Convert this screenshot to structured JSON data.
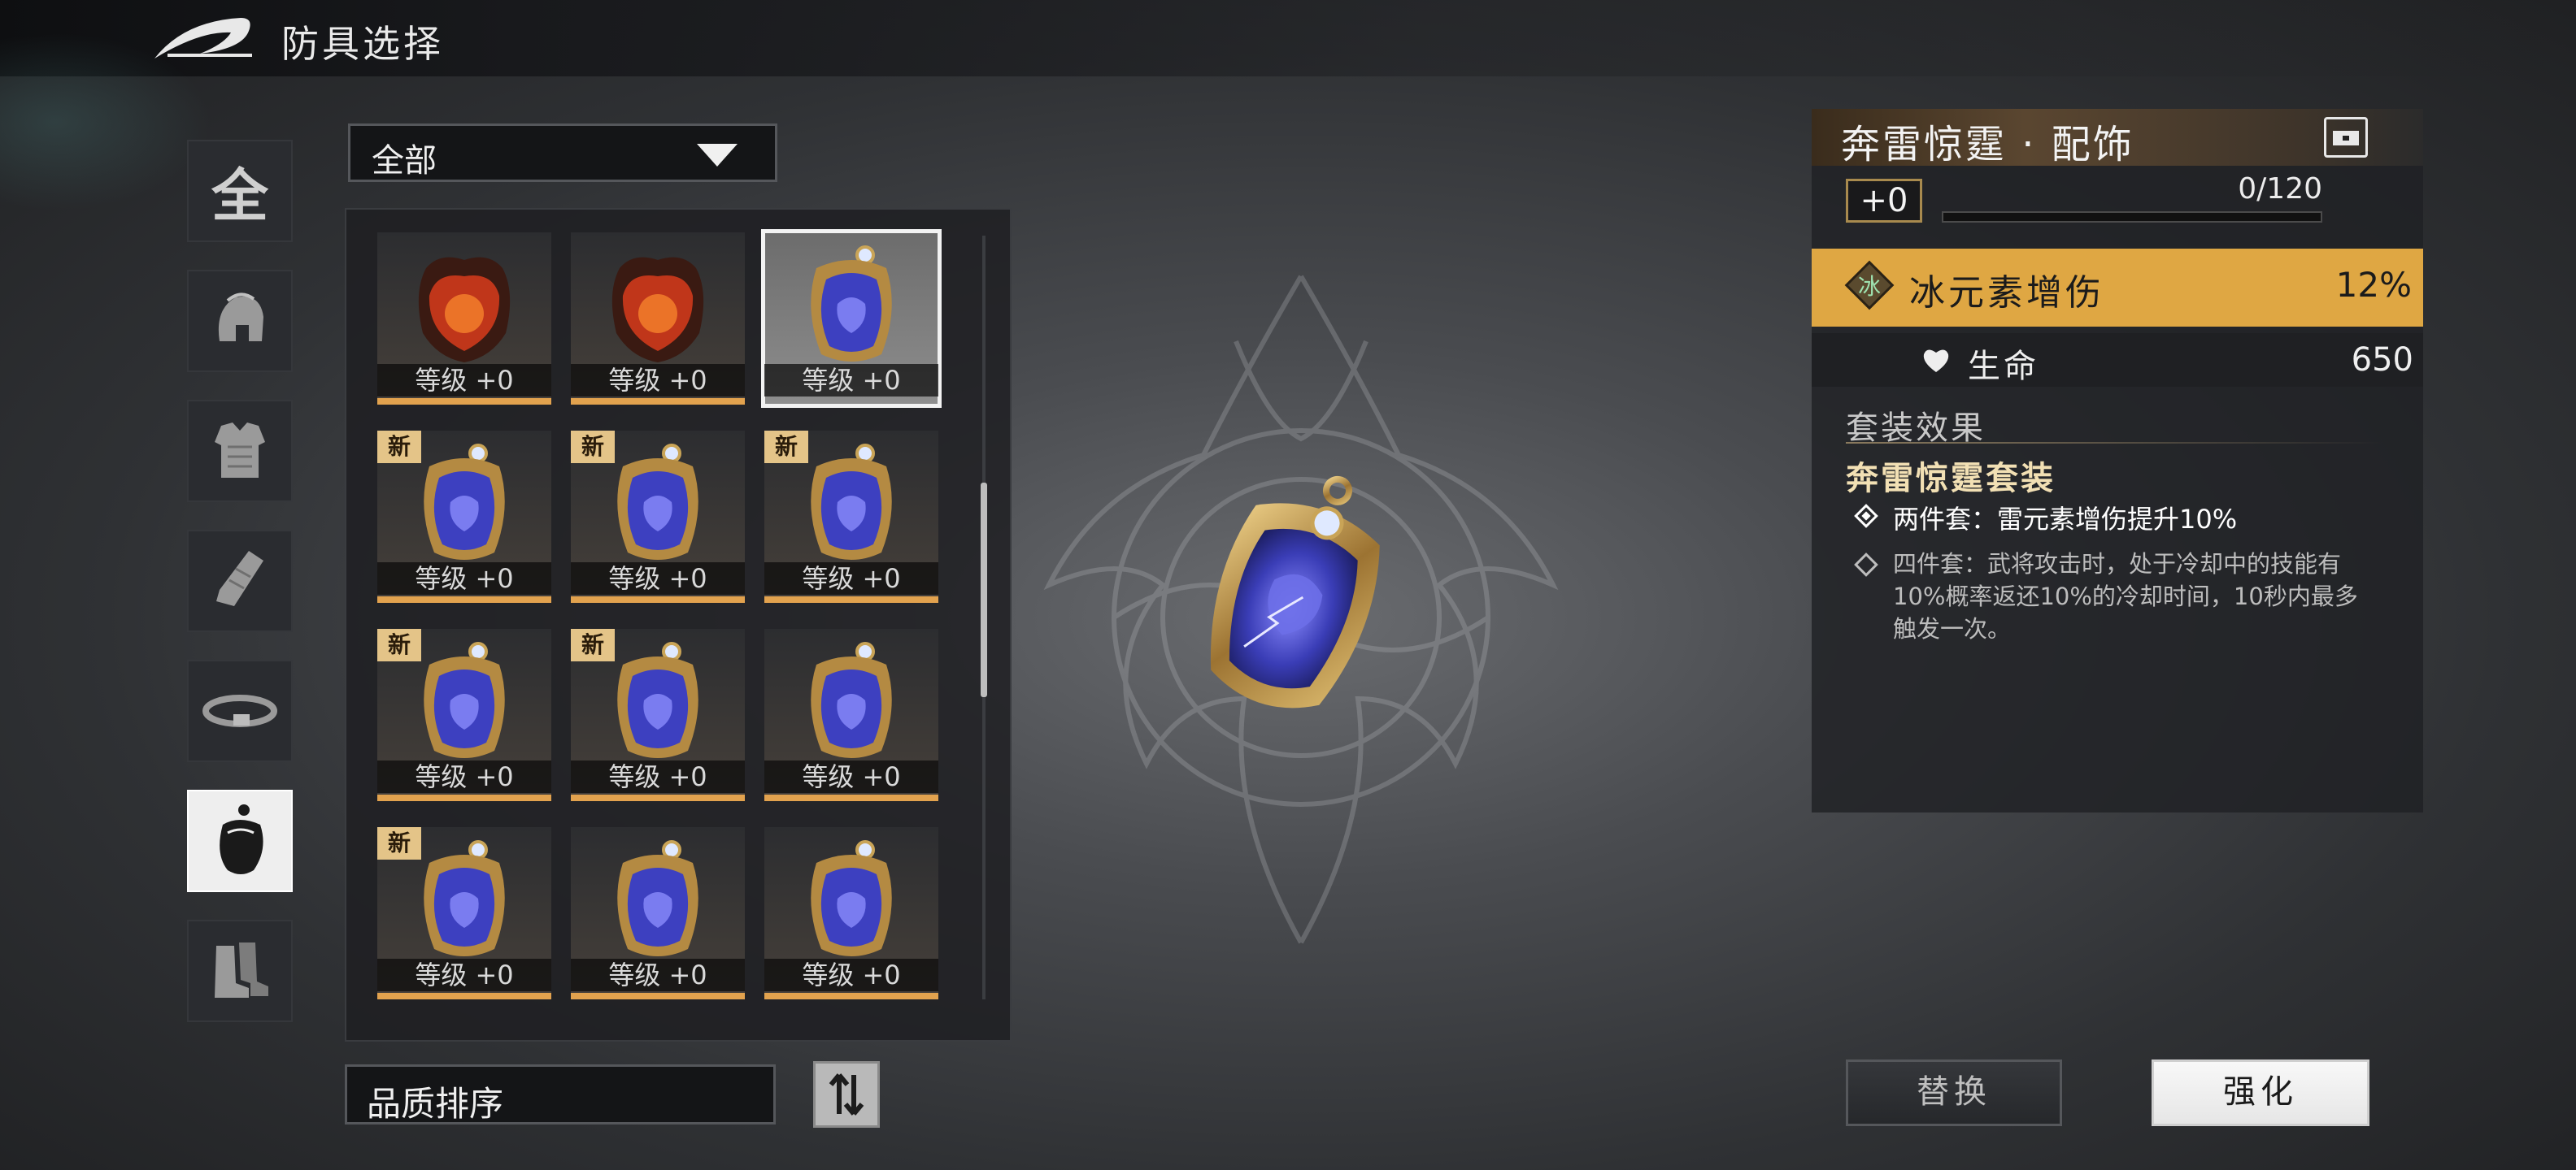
{
  "header": {
    "title": "防具选择",
    "back_icon": "back-arrow-icon"
  },
  "filter": {
    "selected": "全部"
  },
  "categories": [
    {
      "label": "全",
      "icon": "all-icon",
      "selected": false
    },
    {
      "icon": "helmet-icon",
      "selected": false
    },
    {
      "icon": "chest-armor-icon",
      "selected": false
    },
    {
      "icon": "bracer-icon",
      "selected": false
    },
    {
      "icon": "belt-icon",
      "selected": false
    },
    {
      "icon": "accessory-icon",
      "selected": true
    },
    {
      "icon": "boots-icon",
      "selected": false
    }
  ],
  "items": [
    {
      "kind": "fire",
      "level_label": "等级 +0",
      "is_new": false,
      "selected": false
    },
    {
      "kind": "fire",
      "level_label": "等级 +0",
      "is_new": false,
      "selected": false
    },
    {
      "kind": "thunder",
      "level_label": "等级 +0",
      "is_new": false,
      "selected": true
    },
    {
      "kind": "thunder",
      "level_label": "等级 +0",
      "is_new": true,
      "new_label": "新",
      "selected": false
    },
    {
      "kind": "thunder",
      "level_label": "等级 +0",
      "is_new": true,
      "new_label": "新",
      "selected": false
    },
    {
      "kind": "thunder",
      "level_label": "等级 +0",
      "is_new": true,
      "new_label": "新",
      "selected": false
    },
    {
      "kind": "thunder",
      "level_label": "等级 +0",
      "is_new": true,
      "new_label": "新",
      "selected": false
    },
    {
      "kind": "thunder",
      "level_label": "等级 +0",
      "is_new": true,
      "new_label": "新",
      "selected": false
    },
    {
      "kind": "thunder",
      "level_label": "等级 +0",
      "is_new": false,
      "selected": false
    },
    {
      "kind": "thunder",
      "level_label": "等级 +0",
      "is_new": true,
      "new_label": "新",
      "selected": false
    },
    {
      "kind": "thunder",
      "level_label": "等级 +0",
      "is_new": false,
      "selected": false
    },
    {
      "kind": "thunder",
      "level_label": "等级 +0",
      "is_new": false,
      "selected": false
    }
  ],
  "sort": {
    "label": "品质排序",
    "icon": "sort-toggle-icon"
  },
  "detail": {
    "name": "奔雷惊霆 · 配饰",
    "enhance_level": "+0",
    "exp_text": "0/120",
    "exp_fraction": 0,
    "main_stat": {
      "icon_glyph": "冰",
      "name": "冰元素增伤",
      "value": "12%"
    },
    "sub_stat": {
      "name": "生命",
      "value": "650"
    },
    "set_heading": "套装效果",
    "set_name": "奔雷惊霆套装",
    "set_effects": [
      {
        "text": "两件套：雷元素增伤提升10%",
        "active": true
      },
      {
        "text": "四件套：武将攻击时，处于冷却中的技能有10%概率返还10%的冷却时间，10秒内最多触发一次。",
        "active": false
      }
    ]
  },
  "buttons": {
    "replace": "替换",
    "enhance": "强化"
  },
  "colors": {
    "accent_gold": "#dfa743",
    "level_bar": "#e2a24e",
    "new_badge": "#e4c488"
  }
}
